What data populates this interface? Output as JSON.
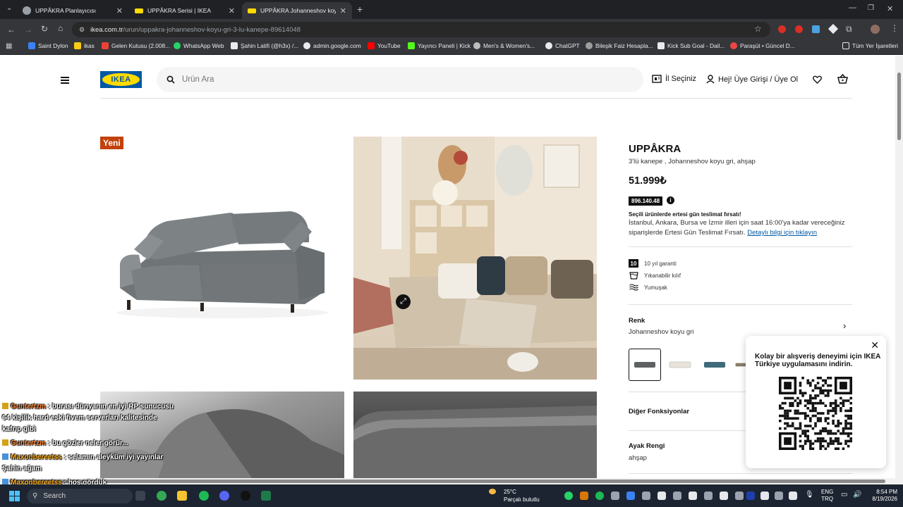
{
  "browser": {
    "tabs": [
      {
        "title": "UPPÅKRA Planlayıcısı",
        "active": false
      },
      {
        "title": "UPPÅKRA Serisi | IKEA",
        "active": false
      },
      {
        "title": "UPPÅKRA Johanneshov koyu gri",
        "active": true
      }
    ],
    "url_domain": "ikea.com.tr",
    "url_path": "/urun/uppakra-johanneshov-koyu-gri-3-lu-kanepe-89614048",
    "bookmarks": [
      "Saint Dylon",
      "ikas",
      "Gelen Kutusu (2.008...",
      "WhatsApp Web",
      "Şahin Latifi (@h3x) /...",
      "admin.google.com",
      "YouTube",
      "Yayıncı Paneli | Kick",
      "Men's & Women's...",
      "ChatGPT",
      "Bileşik Faiz Hesapla...",
      "Kick Sub Goal - Dail...",
      "Paraşüt • Güncel D..."
    ],
    "bookmarks_all": "Tüm Yer İşaretleri"
  },
  "header": {
    "logo": "IKEA",
    "search_placeholder": "Ürün Ara",
    "region": "İl Seçiniz",
    "login": "Hej! Üye Girişi / Üye Ol"
  },
  "product": {
    "badge": "Yeni",
    "name": "UPPÅKRA",
    "description": "3'lü kanepe , Johanneshov koyu gri, ahşap",
    "price": "51.999₺",
    "article_no": "896.140.48",
    "delivery_title": "Seçili ürünlerde ertesi gün teslimat fırsatı!",
    "delivery_text": "İstanbul, Ankara, Bursa ve İzmir illeri için saat 16:00'ya kadar vereceğiniz siparişlerde Ertesi Gün Teslimat Fırsatı.",
    "delivery_link": "Detaylı bilgi için tıklayın",
    "features": [
      {
        "icon": "warranty-icon",
        "badge": "10",
        "label": "10 yıl garanti"
      },
      {
        "icon": "washable-icon",
        "label": "Yıkanabilir kılıf"
      },
      {
        "icon": "soft-icon",
        "label": "Yumuşak"
      }
    ],
    "color_label": "Renk",
    "color_value": "Johanneshov koyu gri",
    "other_functions": "Diğer Fonksiyonlar",
    "leg_color_label": "Ayak Rengi",
    "leg_color_value": "ahşap"
  },
  "swatch_colors": [
    "#5d6163",
    "#e7e3d8",
    "#3f6a7a",
    "#8a7d6a"
  ],
  "qr_popup": {
    "text": "Kolay bir alışveriş deneyimi için IKEA Türkiye uygulamasını indirin."
  },
  "chat": [
    {
      "user": "Guntertzm",
      "text": " : burası dünyanın en iyi RP sunucusu"
    },
    {
      "user": "",
      "text": "64 kişilik hard eski fivem serverları kalitesinde"
    },
    {
      "user": "",
      "text": "kafrıp gibi"
    },
    {
      "user": "Guntertzm",
      "text": " : bu gözler neler görür..."
    },
    {
      "user": "Maxonbereetss",
      "text": " : selamın aleyküm iyi yayınlar"
    },
    {
      "user": "",
      "text": "Şahin ağam"
    },
    {
      "user": "Maxonbereetss",
      "text": " : hoş gördük"
    }
  ],
  "taskbar": {
    "search": "Search",
    "weather_temp": "25°C",
    "weather_desc": "Parçalı bulutlu",
    "lang1": "ENG",
    "lang2": "TRQ",
    "time": "8:54 PM",
    "date": "8/19/2026"
  },
  "colors": {
    "ikea_blue": "#0058a3",
    "ikea_yellow": "#ffdb00",
    "new_badge": "#c2410c",
    "link": "#0058a3"
  }
}
